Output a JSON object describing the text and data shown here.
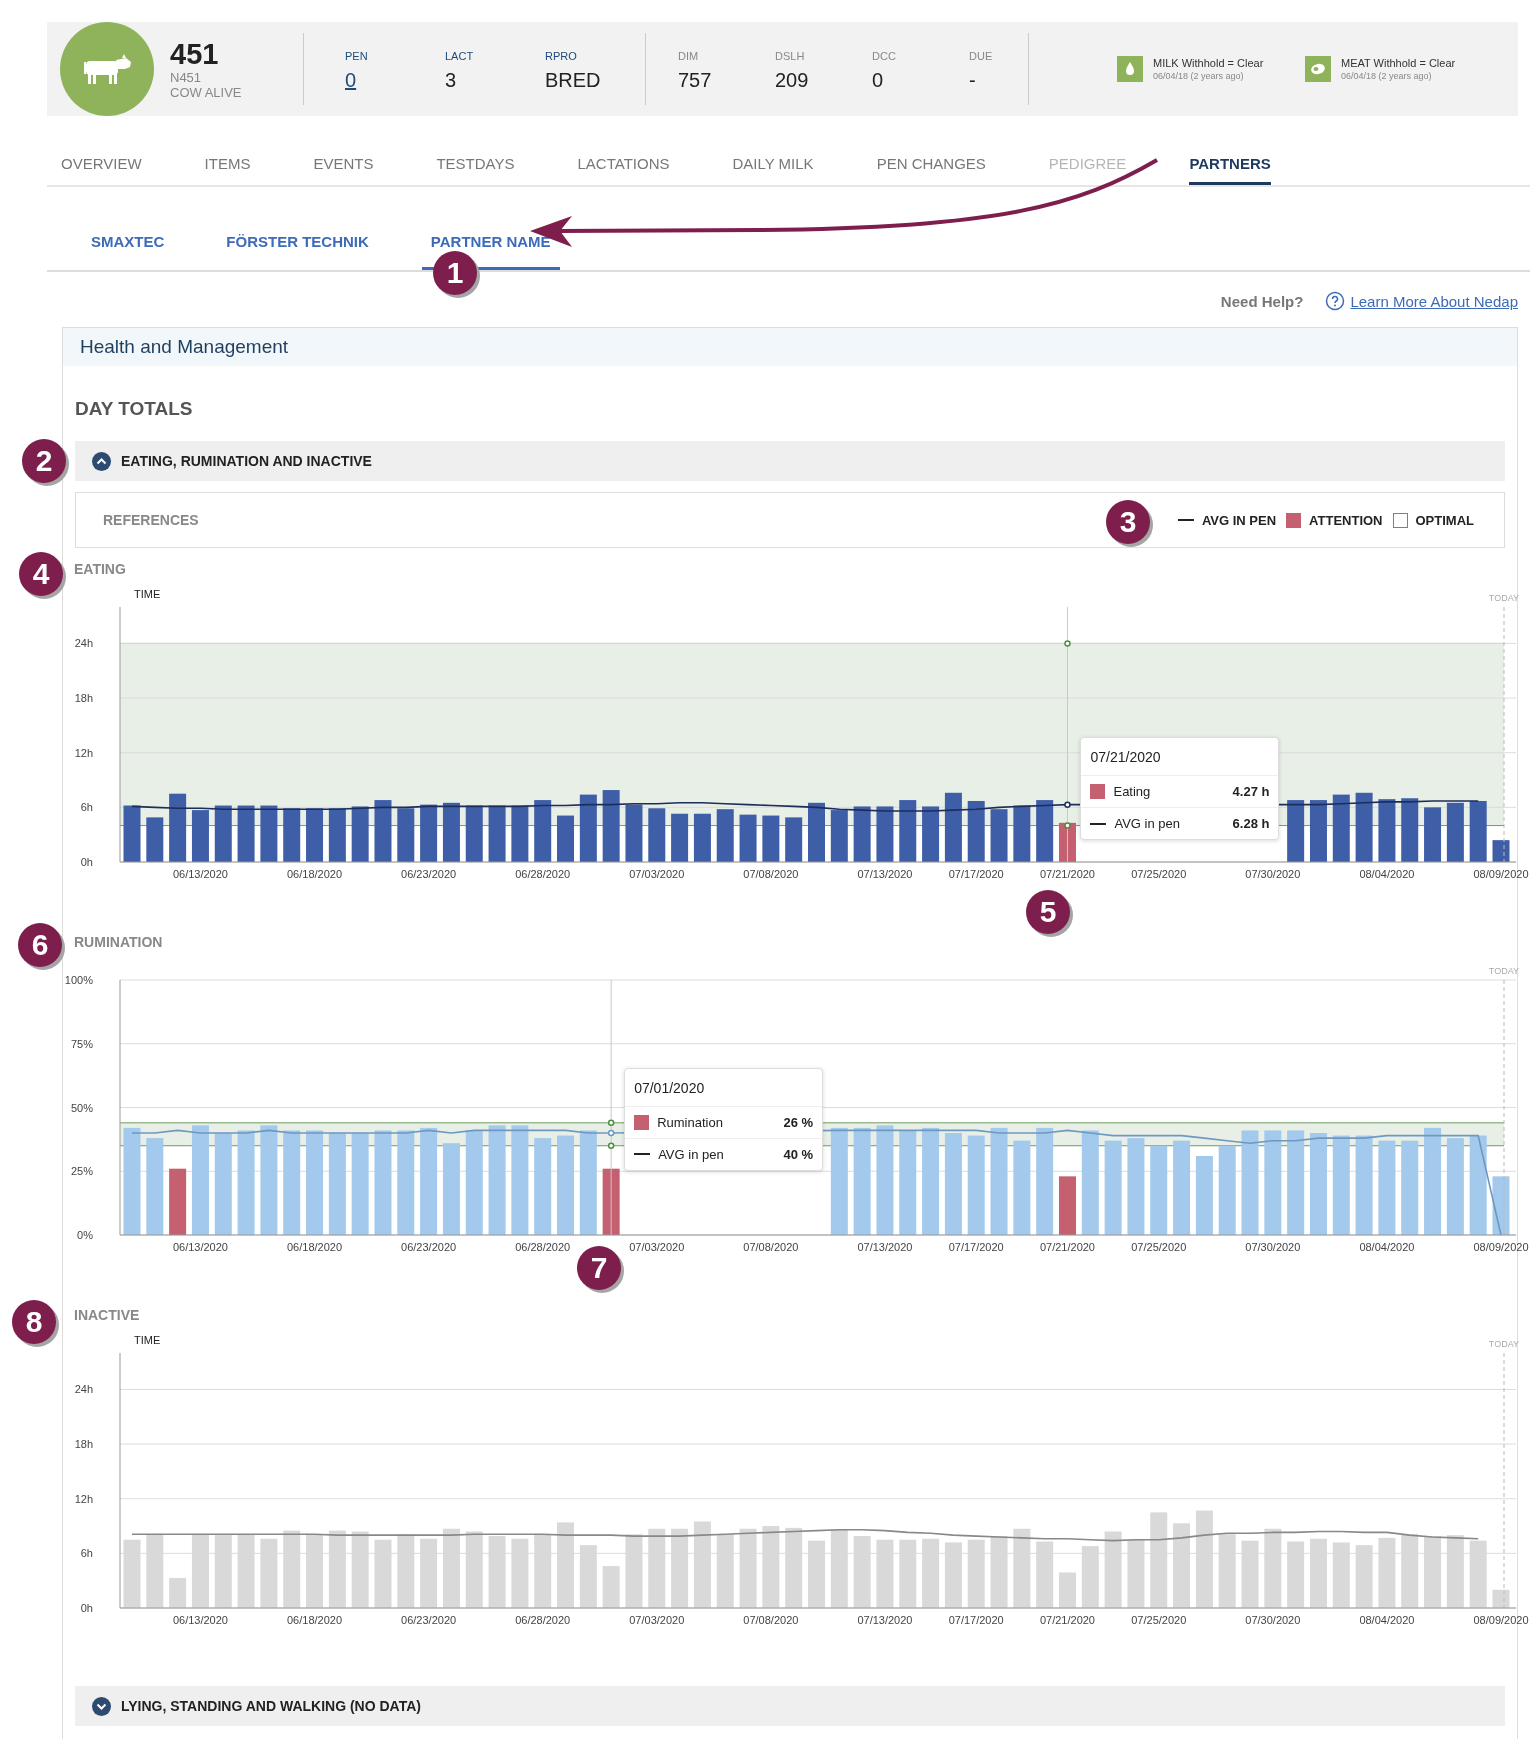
{
  "animal": {
    "number": "451",
    "id": "N451",
    "status": "COW ALIVE"
  },
  "stat_groups": [
    {
      "kind": "primary",
      "stats": [
        {
          "label": "PEN",
          "value": "0",
          "link": true
        },
        {
          "label": "LACT",
          "value": "3",
          "link": false
        },
        {
          "label": "RPRO",
          "value": "BRED",
          "link": false
        }
      ]
    },
    {
      "kind": "secondary",
      "stats": [
        {
          "label": "DIM",
          "value": "757",
          "link": false
        },
        {
          "label": "DSLH",
          "value": "209",
          "link": false
        },
        {
          "label": "DCC",
          "value": "0",
          "link": false
        },
        {
          "label": "DUE",
          "value": "-",
          "link": false
        }
      ]
    }
  ],
  "withholds": [
    {
      "kind": "milk",
      "title": "MILK Withhold = Clear",
      "date": "06/04/18 (2 years ago)"
    },
    {
      "kind": "meat",
      "title": "MEAT Withhold = Clear",
      "date": "06/04/18 (2 years ago)"
    }
  ],
  "tabs": [
    {
      "label": "OVERVIEW",
      "selected": false,
      "disabled": false
    },
    {
      "label": "ITEMS",
      "selected": false,
      "disabled": false
    },
    {
      "label": "EVENTS",
      "selected": false,
      "disabled": false
    },
    {
      "label": "TESTDAYS",
      "selected": false,
      "disabled": false
    },
    {
      "label": "LACTATIONS",
      "selected": false,
      "disabled": false
    },
    {
      "label": "DAILY MILK",
      "selected": false,
      "disabled": false
    },
    {
      "label": "PEN CHANGES",
      "selected": false,
      "disabled": false
    },
    {
      "label": "PEDIGREE",
      "selected": false,
      "disabled": true
    },
    {
      "label": "PARTNERS",
      "selected": true,
      "disabled": false
    }
  ],
  "partner_tabs": [
    {
      "label": "SMAXTEC",
      "selected": false
    },
    {
      "label": "FÖRSTER TECHNIK",
      "selected": false
    },
    {
      "label": "PARTNER NAME",
      "selected": true
    }
  ],
  "help": {
    "label": "Need Help?",
    "link": "Learn More About Nedap"
  },
  "panel": {
    "title": "Health and Management",
    "section": "DAY TOTALS"
  },
  "groups": [
    {
      "title": "EATING, RUMINATION AND INACTIVE",
      "expanded": true
    },
    {
      "title": "LYING, STANDING AND WALKING (NO DATA)",
      "expanded": false
    }
  ],
  "references": {
    "label": "REFERENCES",
    "legend": [
      {
        "kind": "line",
        "label": "AVG IN PEN"
      },
      {
        "kind": "attention",
        "label": "ATTENTION",
        "color": "#c4606f"
      },
      {
        "kind": "optimal",
        "label": "OPTIMAL",
        "color": "#5a9a4a"
      }
    ]
  },
  "charts": [
    {
      "chart_data": {
        "type": "bar",
        "title": "EATING",
        "ylabel": "TIME",
        "ylim": [
          0,
          28
        ],
        "grid": true,
        "categories": [
          null,
          null,
          null,
          "06/13/2020",
          null,
          null,
          null,
          null,
          "06/18/2020",
          null,
          null,
          null,
          null,
          "06/23/2020",
          null,
          null,
          null,
          null,
          "06/28/2020",
          null,
          null,
          null,
          null,
          "07/03/2020",
          null,
          null,
          null,
          null,
          "07/08/2020",
          null,
          null,
          null,
          null,
          "07/13/2020",
          null,
          null,
          null,
          "07/17/2020",
          null,
          null,
          null,
          "07/21/2020",
          null,
          null,
          null,
          "07/25/2020",
          null,
          null,
          null,
          null,
          "07/30/2020",
          null,
          null,
          null,
          null,
          "08/04/2020",
          null,
          null,
          null,
          null,
          "08/09/2020"
        ],
        "yticks": [
          {
            "value": 0,
            "label": "0h"
          },
          {
            "value": 6,
            "label": "6h"
          },
          {
            "value": 12,
            "label": "12h"
          },
          {
            "value": 18,
            "label": "18h"
          },
          {
            "value": 24,
            "label": "24h"
          }
        ],
        "series": [
          {
            "type": "bar",
            "color": "#3f5ea8",
            "values": [
              6.2,
              4.9,
              7.5,
              5.7,
              6.2,
              6.2,
              6.2,
              5.9,
              5.9,
              5.9,
              6.1,
              6.8,
              5.9,
              6.3,
              6.5,
              6.2,
              6.2,
              6.2,
              6.8,
              5.1,
              7.4,
              7.9,
              6.3,
              5.9,
              5.3,
              5.3,
              5.8,
              5.2,
              5.1,
              4.9,
              6.5,
              5.7,
              6.1,
              6.1,
              6.8,
              6.1,
              7.6,
              6.7,
              5.8,
              6.2,
              6.8,
              null,
              null,
              null,
              null,
              null,
              null,
              null,
              null,
              null,
              null,
              6.8,
              6.8,
              7.4,
              7.6,
              6.9,
              7.0,
              6.0,
              6.5,
              6.7,
              2.4
            ]
          },
          {
            "type": "bar",
            "color": "#c4606f",
            "values": [
              null,
              null,
              null,
              null,
              null,
              null,
              null,
              null,
              null,
              null,
              null,
              null,
              null,
              null,
              null,
              null,
              null,
              null,
              null,
              null,
              null,
              null,
              null,
              null,
              null,
              null,
              null,
              null,
              null,
              null,
              null,
              null,
              null,
              null,
              null,
              null,
              null,
              null,
              null,
              null,
              null,
              4.3,
              null,
              null,
              null,
              null,
              null,
              null,
              null,
              null,
              null,
              null,
              null,
              null,
              null,
              null,
              null,
              null,
              null,
              null,
              null
            ]
          },
          {
            "type": "line",
            "color": "#1e2d5c",
            "values": [
              6.1,
              6.0,
              5.9,
              5.9,
              5.8,
              5.8,
              5.8,
              5.8,
              5.8,
              5.8,
              5.9,
              6.0,
              6.0,
              6.1,
              6.1,
              6.1,
              6.1,
              6.1,
              6.2,
              6.2,
              6.3,
              6.3,
              6.4,
              6.4,
              6.5,
              6.5,
              6.4,
              6.3,
              6.2,
              6.1,
              6.0,
              5.8,
              5.7,
              5.6,
              5.6,
              5.6,
              5.7,
              5.8,
              6.0,
              6.1,
              6.2,
              6.3,
              null,
              null,
              null,
              null,
              null,
              null,
              null,
              null,
              null,
              6.3,
              6.3,
              6.4,
              6.5,
              6.6,
              6.6,
              6.7,
              6.7,
              6.7,
              null
            ]
          }
        ],
        "bands": [
          {
            "axis": "y",
            "from": 4,
            "to": 24
          }
        ],
        "ref_lines": [
          {
            "axis": "y",
            "value": 24
          },
          {
            "axis": "y",
            "value": 4
          }
        ]
      },
      "today_label": "TODAY",
      "tooltip": {
        "title": "07/21/2020",
        "rows": [
          {
            "kind": "bar",
            "label": "Eating",
            "value": "4.27 h",
            "color": "#c4606f"
          },
          {
            "kind": "line",
            "label": "AVG in pen",
            "value": "6.28 h"
          }
        ]
      }
    },
    {
      "chart_data": {
        "type": "bar",
        "title": "RUMINATION",
        "ylim": [
          0,
          100
        ],
        "grid": true,
        "categories": [
          null,
          null,
          null,
          "06/13/2020",
          null,
          null,
          null,
          null,
          "06/18/2020",
          null,
          null,
          null,
          null,
          "06/23/2020",
          null,
          null,
          null,
          null,
          "06/28/2020",
          null,
          null,
          null,
          null,
          "07/03/2020",
          null,
          null,
          null,
          null,
          "07/08/2020",
          null,
          null,
          null,
          null,
          "07/13/2020",
          null,
          null,
          null,
          "07/17/2020",
          null,
          null,
          null,
          "07/21/2020",
          null,
          null,
          null,
          "07/25/2020",
          null,
          null,
          null,
          null,
          "07/30/2020",
          null,
          null,
          null,
          null,
          "08/04/2020",
          null,
          null,
          null,
          null,
          "08/09/2020"
        ],
        "yticks": [
          {
            "value": 0,
            "label": "0%"
          },
          {
            "value": 25,
            "label": "25%"
          },
          {
            "value": 50,
            "label": "50%"
          },
          {
            "value": 75,
            "label": "75%"
          },
          {
            "value": 100,
            "label": "100%"
          }
        ],
        "series": [
          {
            "type": "bar",
            "color": "#a3c9ec",
            "values": [
              42,
              38,
              null,
              43,
              40,
              41,
              43,
              41,
              41,
              40,
              40,
              41,
              41,
              42,
              36,
              41,
              43,
              43,
              38,
              39,
              41,
              null,
              null,
              null,
              null,
              null,
              null,
              null,
              null,
              null,
              null,
              42,
              42,
              43,
              41,
              42,
              40,
              39,
              42,
              37,
              42,
              null,
              41,
              37,
              38,
              35,
              37,
              31,
              35,
              41,
              41,
              41,
              40,
              39,
              39,
              37,
              37,
              42,
              38,
              39,
              23
            ]
          },
          {
            "type": "bar",
            "color": "#c4606f",
            "values": [
              null,
              null,
              26,
              null,
              null,
              null,
              null,
              null,
              null,
              null,
              null,
              null,
              null,
              null,
              null,
              null,
              null,
              null,
              null,
              null,
              null,
              26,
              null,
              null,
              null,
              null,
              null,
              null,
              null,
              null,
              null,
              null,
              null,
              null,
              null,
              null,
              null,
              null,
              null,
              null,
              null,
              23,
              null,
              null,
              null,
              null,
              null,
              null,
              null,
              null,
              null,
              null,
              null,
              null,
              null,
              null,
              null,
              null,
              null,
              null,
              null
            ]
          },
          {
            "type": "line",
            "color": "#6f98c0",
            "values": [
              40,
              40,
              41,
              40,
              40,
              40,
              41,
              40,
              40,
              40,
              40,
              40,
              40,
              41,
              40,
              41,
              41,
              41,
              41,
              41,
              40,
              40,
              null,
              null,
              null,
              null,
              null,
              null,
              null,
              null,
              null,
              41,
              41,
              41,
              41,
              41,
              41,
              41,
              40,
              40,
              40,
              41,
              40,
              39,
              39,
              39,
              39,
              38,
              37,
              36,
              37,
              37,
              38,
              38,
              38,
              39,
              39,
              39,
              39,
              39,
              0
            ]
          }
        ],
        "bands": [
          {
            "axis": "y",
            "from": 35,
            "to": 44
          }
        ],
        "ref_lines": [
          {
            "axis": "y",
            "value": 44
          },
          {
            "axis": "y",
            "value": 35
          }
        ]
      },
      "today_label": "TODAY",
      "tooltip": {
        "title": "07/01/2020",
        "rows": [
          {
            "kind": "bar",
            "label": "Rumination",
            "value": "26 %",
            "color": "#c4606f"
          },
          {
            "kind": "line",
            "label": "AVG in pen",
            "value": "40 %"
          }
        ]
      }
    },
    {
      "chart_data": {
        "type": "bar",
        "title": "INACTIVE",
        "ylabel": "TIME",
        "ylim": [
          0,
          28
        ],
        "grid": true,
        "categories": [
          null,
          null,
          null,
          "06/13/2020",
          null,
          null,
          null,
          null,
          "06/18/2020",
          null,
          null,
          null,
          null,
          "06/23/2020",
          null,
          null,
          null,
          null,
          "06/28/2020",
          null,
          null,
          null,
          null,
          "07/03/2020",
          null,
          null,
          null,
          null,
          "07/08/2020",
          null,
          null,
          null,
          null,
          "07/13/2020",
          null,
          null,
          null,
          "07/17/2020",
          null,
          null,
          null,
          "07/21/2020",
          null,
          null,
          null,
          "07/25/2020",
          null,
          null,
          null,
          null,
          "07/30/2020",
          null,
          null,
          null,
          null,
          "08/04/2020",
          null,
          null,
          null,
          null,
          "08/09/2020"
        ],
        "yticks": [
          {
            "value": 0,
            "label": "0h"
          },
          {
            "value": 6,
            "label": "6h"
          },
          {
            "value": 12,
            "label": "12h"
          },
          {
            "value": 18,
            "label": "18h"
          },
          {
            "value": 24,
            "label": "24h"
          }
        ],
        "series": [
          {
            "type": "bar",
            "color": "#d9d9d9",
            "values": [
              7.5,
              8.1,
              3.3,
              8.1,
              8.0,
              8.1,
              7.6,
              8.5,
              8.1,
              8.5,
              8.4,
              7.5,
              8.1,
              7.6,
              8.7,
              8.4,
              7.9,
              7.6,
              8.1,
              9.4,
              6.9,
              4.6,
              8.1,
              8.7,
              8.7,
              9.5,
              8.1,
              8.7,
              9.0,
              8.8,
              7.4,
              8.6,
              7.9,
              7.5,
              7.5,
              7.6,
              7.2,
              7.5,
              7.9,
              8.7,
              7.3,
              3.9,
              6.8,
              8.4,
              7.5,
              10.5,
              9.3,
              10.7,
              8.1,
              7.4,
              8.7,
              7.3,
              7.6,
              7.2,
              6.9,
              7.7,
              8.1,
              7.9,
              8.0,
              7.4,
              2.0
            ]
          },
          {
            "type": "line",
            "color": "#888888",
            "values": [
              8.1,
              8.1,
              8.1,
              8.1,
              8.1,
              8.1,
              8.1,
              8.1,
              8.1,
              8.0,
              8.0,
              8.0,
              8.0,
              8.0,
              8.0,
              8.1,
              8.1,
              8.1,
              8.1,
              8.0,
              8.0,
              8.0,
              7.9,
              7.9,
              7.9,
              8.0,
              8.1,
              8.2,
              8.3,
              8.4,
              8.5,
              8.6,
              8.6,
              8.5,
              8.3,
              8.2,
              8.0,
              7.9,
              7.8,
              7.7,
              7.6,
              7.6,
              7.5,
              7.4,
              7.5,
              7.5,
              7.7,
              8.0,
              8.2,
              8.2,
              8.3,
              8.3,
              8.4,
              8.4,
              8.3,
              8.3,
              8.0,
              7.8,
              7.7,
              7.6,
              null
            ]
          }
        ]
      },
      "today_label": "TODAY"
    }
  ],
  "callouts": [
    {
      "label": "1"
    },
    {
      "label": "2"
    },
    {
      "label": "3"
    },
    {
      "label": "4"
    },
    {
      "label": "5"
    },
    {
      "label": "6"
    },
    {
      "label": "7"
    },
    {
      "label": "8"
    }
  ]
}
